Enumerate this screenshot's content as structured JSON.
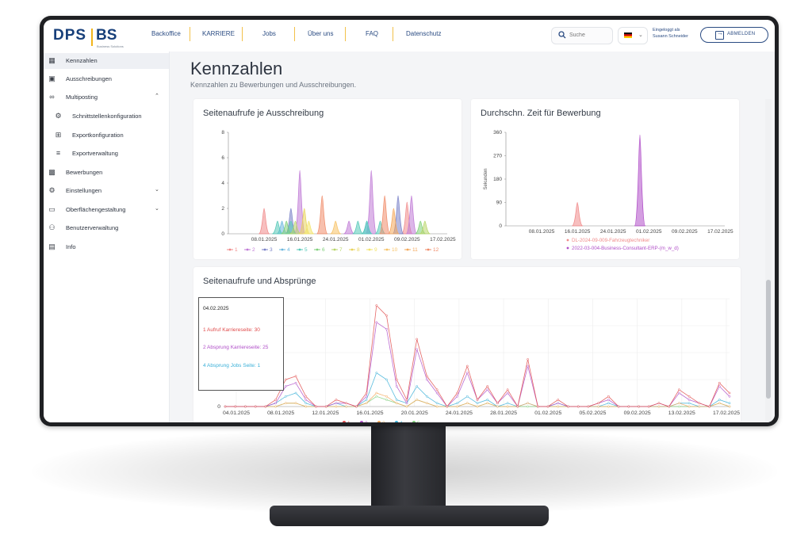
{
  "app": {
    "logo_left": "DPS",
    "logo_right": "BS",
    "logo_sub": "Business Solutions"
  },
  "nav": {
    "items": [
      "Backoffice",
      "KARRIERE",
      "Jobs",
      "Über uns",
      "FAQ",
      "Datenschutz"
    ],
    "search_placeholder": "Suche",
    "login_line1": "Eingeloggt als",
    "login_line2": "Susann Schneider",
    "logout_label": "ABMELDEN"
  },
  "sidebar": {
    "items": [
      {
        "label": "Kennzahlen",
        "icon": "dashboard-icon"
      },
      {
        "label": "Ausschreibungen",
        "icon": "documents-icon"
      },
      {
        "label": "Multiposting",
        "icon": "share-icon"
      },
      {
        "label": "Schnittstellenkonfiguration",
        "icon": "gear-icon"
      },
      {
        "label": "Exportkonfiguration",
        "icon": "plus-box-icon"
      },
      {
        "label": "Exportverwaltung",
        "icon": "list-icon"
      },
      {
        "label": "Bewerbungen",
        "icon": "person-icon"
      },
      {
        "label": "Einstellungen",
        "icon": "gear-icon"
      },
      {
        "label": "Oberflächengestaltung",
        "icon": "monitor-icon"
      },
      {
        "label": "Benutzerverwaltung",
        "icon": "users-icon"
      },
      {
        "label": "Info",
        "icon": "info-icon"
      }
    ]
  },
  "page": {
    "title": "Kennzahlen",
    "subtitle": "Kennzahlen zu Bewerbungen und Ausschreibungen."
  },
  "chart1_title": "Seitenaufrufe je Ausschreibung",
  "chart2_title": "Durchschn. Zeit für Bewerbung",
  "chart3_title": "Seitenaufrufe und Absprünge",
  "tooltip": {
    "date": "04.02.2025",
    "line1": "1 Aufruf Karriereseite: 30",
    "line2": "2 Absprung Karriereseite: 25",
    "line3": "4 Absprung Jobs Seite: 1",
    "color1": "#e04b4b",
    "color2": "#b04fc8",
    "color3": "#3bb0d8"
  },
  "chart_data": [
    {
      "type": "area",
      "title": "Seitenaufrufe je Ausschreibung",
      "x_ticks": [
        "08.01.2025",
        "16.01.2025",
        "24.01.2025",
        "01.02.2025",
        "09.02.2025",
        "17.02.2025"
      ],
      "y_ticks": [
        0,
        2,
        4,
        6,
        8
      ],
      "ylim": [
        0,
        8
      ],
      "x_range_days": [
        0,
        49
      ],
      "series": [
        {
          "name": "1",
          "color": "#f08a8a",
          "peaks": [
            [
              8,
              2
            ],
            [
              40,
              2.5
            ]
          ]
        },
        {
          "name": "2",
          "color": "#c07ad6",
          "peaks": [
            [
              16,
              5
            ],
            [
              27,
              1
            ],
            [
              32,
              5
            ],
            [
              41,
              3
            ]
          ]
        },
        {
          "name": "3",
          "color": "#7a82c8",
          "peaks": [
            [
              14,
              2
            ],
            [
              38,
              3
            ]
          ]
        },
        {
          "name": "4",
          "color": "#6ab7de",
          "peaks": [
            [
              12,
              1
            ],
            [
              31,
              1
            ]
          ]
        },
        {
          "name": "5",
          "color": "#55c9b8",
          "peaks": [
            [
              11,
              1
            ],
            [
              14,
              1
            ],
            [
              29,
              1
            ],
            [
              31,
              1
            ],
            [
              34,
              1
            ]
          ]
        },
        {
          "name": "6",
          "color": "#7fcf7a",
          "peaks": [
            [
              13,
              1
            ],
            [
              43,
              1
            ]
          ]
        },
        {
          "name": "7",
          "color": "#b8d66a",
          "peaks": [
            [
              15,
              1
            ],
            [
              44,
              1
            ]
          ]
        },
        {
          "name": "8",
          "color": "#e8d35a",
          "peaks": [
            [
              17,
              2
            ]
          ]
        },
        {
          "name": "9",
          "color": "#f2e46a",
          "peaks": [
            [
              18,
              1
            ]
          ]
        },
        {
          "name": "10",
          "color": "#f7c266",
          "peaks": [
            [
              24,
              1
            ]
          ]
        },
        {
          "name": "11",
          "color": "#f4a85a",
          "peaks": [
            [
              37,
              2
            ]
          ]
        },
        {
          "name": "12",
          "color": "#f08c6a",
          "peaks": [
            [
              21,
              3
            ],
            [
              35,
              3
            ]
          ]
        }
      ]
    },
    {
      "type": "area",
      "title": "Durchschn. Zeit für Bewerbung",
      "ylabel": "Sekunden",
      "x_ticks": [
        "08.01.2025",
        "16.01.2025",
        "24.01.2025",
        "01.02.2025",
        "09.02.2025",
        "17.02.2025"
      ],
      "y_ticks": [
        0,
        90,
        180,
        270,
        360
      ],
      "ylim": [
        0,
        360
      ],
      "x_range_days": [
        0,
        49
      ],
      "series": [
        {
          "name": "DL-2024-09-009-Fahrzeugtechniker",
          "color": "#f08a8a",
          "peaks": [
            [
              16,
              90
            ]
          ]
        },
        {
          "name": "2022-03-004-Business-Consultant-ERP-(m_w_d)",
          "color": "#b04fc8",
          "peaks": [
            [
              30,
              350
            ]
          ]
        }
      ]
    },
    {
      "type": "line",
      "title": "Seitenaufrufe und Absprünge",
      "x_ticks": [
        "04.01.2025",
        "08.01.2025",
        "12.01.2025",
        "16.01.2025",
        "20.01.2025",
        "24.01.2025",
        "28.01.2025",
        "01.02.2025",
        "05.02.2025",
        "09.02.2025",
        "13.02.2025",
        "17.02.2025"
      ],
      "y_ticks": [
        0,
        9
      ],
      "series": [
        {
          "name": "1",
          "color": "#e04b4b",
          "values": [
            0,
            0,
            0,
            0,
            0,
            2,
            8,
            9,
            3,
            0,
            0,
            2,
            1,
            0,
            4,
            30,
            27,
            8,
            2,
            20,
            9,
            5,
            0,
            4,
            12,
            2,
            6,
            1,
            5,
            0,
            14,
            0,
            0,
            2,
            0,
            0,
            0,
            1,
            3,
            0,
            0,
            0,
            0,
            1,
            0,
            5,
            3,
            1,
            0,
            7,
            4
          ]
        },
        {
          "name": "2",
          "color": "#b04fc8",
          "values": [
            0,
            0,
            0,
            0,
            0,
            1,
            6,
            7,
            2,
            0,
            0,
            1,
            1,
            0,
            3,
            25,
            23,
            6,
            1,
            17,
            8,
            4,
            0,
            3,
            10,
            2,
            5,
            1,
            4,
            0,
            12,
            0,
            0,
            1,
            0,
            0,
            0,
            1,
            2,
            0,
            0,
            0,
            0,
            1,
            0,
            4,
            2,
            1,
            0,
            6,
            3
          ]
        },
        {
          "name": "3",
          "color": "#f4a85a",
          "values": [
            0,
            0,
            0,
            0,
            0,
            0,
            1,
            1,
            0,
            0,
            0,
            0,
            0,
            0,
            1,
            4,
            3,
            1,
            0,
            2,
            1,
            0,
            0,
            0,
            1,
            0,
            1,
            0,
            0,
            0,
            1,
            0,
            0,
            0,
            0,
            0,
            0,
            0,
            0,
            0,
            0,
            0,
            0,
            0,
            0,
            1,
            0,
            0,
            0,
            1,
            0
          ]
        },
        {
          "name": "4",
          "color": "#3bb0d8",
          "values": [
            0,
            0,
            0,
            0,
            0,
            1,
            3,
            4,
            1,
            0,
            0,
            1,
            0,
            0,
            2,
            10,
            8,
            2,
            1,
            6,
            3,
            1,
            0,
            1,
            3,
            1,
            2,
            0,
            1,
            0,
            1,
            0,
            0,
            1,
            0,
            0,
            0,
            0,
            1,
            0,
            0,
            0,
            0,
            0,
            0,
            1,
            1,
            0,
            0,
            2,
            1
          ]
        },
        {
          "name": "5",
          "color": "#7fcf7a",
          "values": [
            0,
            0,
            0,
            0,
            0,
            0,
            1,
            1,
            0,
            0,
            0,
            0,
            0,
            0,
            1,
            3,
            2,
            1,
            0,
            2,
            1,
            0,
            0,
            0,
            1,
            0,
            1,
            0,
            0,
            0,
            0,
            0,
            0,
            0,
            0,
            0,
            0,
            0,
            0,
            0,
            0,
            0,
            0,
            0,
            0,
            0,
            0,
            0,
            0,
            1,
            0
          ]
        }
      ]
    }
  ]
}
